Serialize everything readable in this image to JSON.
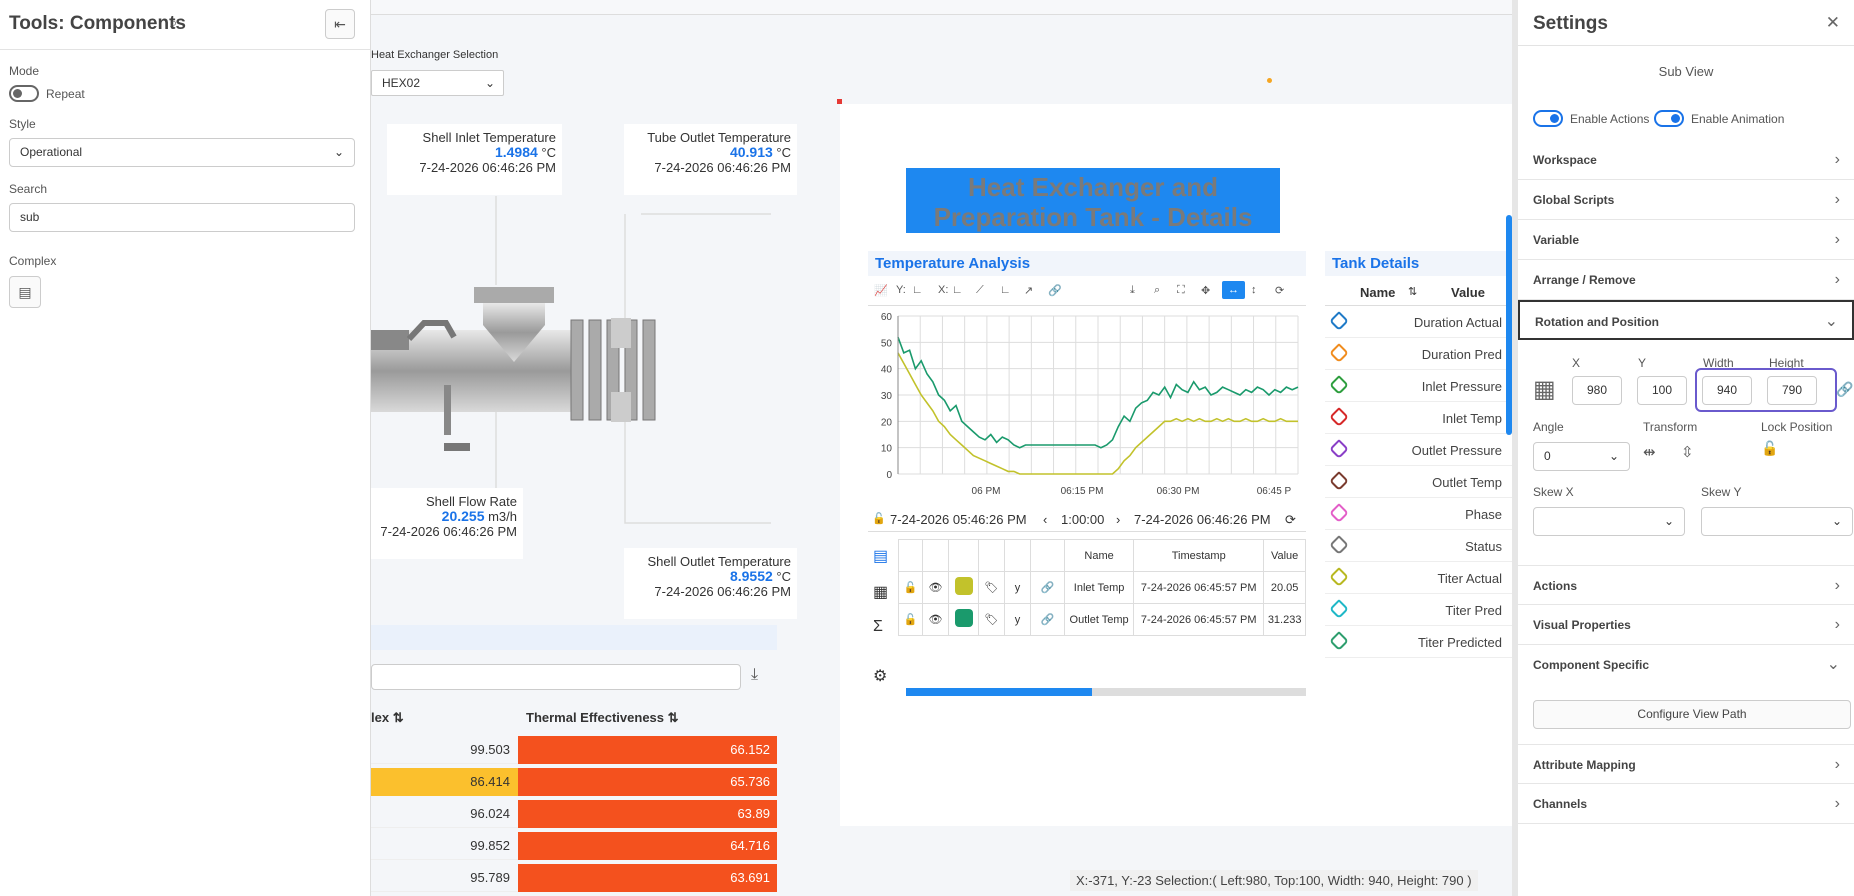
{
  "left_panel": {
    "title": "Tools: Components",
    "mode_label": "Mode",
    "mode_toggle_label": "Repeat",
    "style_label": "Style",
    "style_value": "Operational",
    "search_label": "Search",
    "search_value": "sub",
    "complex_label": "Complex"
  },
  "canvas": {
    "hex_label": "Heat Exchanger Selection",
    "hex_value": "HEX02",
    "cards": [
      {
        "title": "Shell Inlet Temperature",
        "value": "1.4984",
        "unit": " °C",
        "time": "7-24-2026 06:46:26 PM"
      },
      {
        "title": "Tube Outlet Temperature",
        "value": "40.913",
        "unit": " °C",
        "time": "7-24-2026 06:46:26 PM"
      },
      {
        "title": "Shell Flow Rate",
        "value": "20.255",
        "unit": " m3/h",
        "time": "7-24-2026 06:46:26 PM"
      },
      {
        "title": "Shell Outlet Temperature",
        "value": "8.9552",
        "unit": " °C",
        "time": "7-24-2026 06:46:26 PM"
      }
    ],
    "table": {
      "col1": "lex",
      "col2": "Thermal Effectiveness",
      "sort": "⇅",
      "rows": [
        [
          "99.503",
          "66.152"
        ],
        [
          "86.414",
          "65.736"
        ],
        [
          "96.024",
          "63.89"
        ],
        [
          "99.852",
          "64.716"
        ],
        [
          "95.789",
          "63.691"
        ]
      ]
    }
  },
  "detail": {
    "banner": "Heat Exchanger and Preparation Tank - Details",
    "temp_title": "Temperature Analysis",
    "tank_title": "Tank Details",
    "toolbar": {
      "y": "Y:",
      "x": "X:"
    },
    "range": {
      "start": "7-24-2026 05:46:26 PM",
      "interval": "1:00:00",
      "end": "7-24-2026 06:46:26 PM"
    },
    "legend_table": {
      "headers": [
        "Name",
        "Timestamp",
        "Value"
      ],
      "rows": [
        {
          "name": "Inlet Temp",
          "ts": "7-24-2026 06:45:57 PM",
          "value": "20.05",
          "color": "#c2c22b"
        },
        {
          "name": "Outlet Temp",
          "ts": "7-24-2026 06:45:57 PM",
          "value": "31.233",
          "color": "#1a9a6c"
        }
      ]
    },
    "tank": {
      "name_header": "Name",
      "value_header": "Value",
      "sort": "⇅",
      "items": [
        {
          "name": "Duration Actual",
          "color": "#1f7ac7"
        },
        {
          "name": "Duration Pred",
          "color": "#f08c1e"
        },
        {
          "name": "Inlet Pressure",
          "color": "#2e9e3e"
        },
        {
          "name": "Inlet Temp",
          "color": "#d62828"
        },
        {
          "name": "Outlet Pressure",
          "color": "#8a3fc7"
        },
        {
          "name": "Outlet Temp",
          "color": "#7a3b2e"
        },
        {
          "name": "Phase",
          "color": "#e35ec8"
        },
        {
          "name": "Status",
          "color": "#777777"
        },
        {
          "name": "Titer Actual",
          "color": "#b8b820"
        },
        {
          "name": "Titer Pred",
          "color": "#1fb8c7"
        },
        {
          "name": "Titer Predicted",
          "color": "#2e9e6e"
        }
      ]
    }
  },
  "chart_data": {
    "type": "line",
    "x_ticks": [
      "06 PM",
      "06:15 PM",
      "06:30 PM",
      "06:45 P"
    ],
    "ylim": [
      0,
      60
    ],
    "y_ticks": [
      "0",
      "10",
      "20",
      "30",
      "40",
      "50",
      "60"
    ],
    "grid": true,
    "series": [
      {
        "color": "#1a9a6c",
        "values": [
          52,
          46,
          47,
          40,
          43,
          38,
          35,
          30,
          28,
          24,
          26,
          20,
          18,
          16,
          14,
          13,
          15,
          12,
          14,
          13,
          11,
          10,
          11,
          11,
          11,
          11,
          11,
          11,
          11,
          11,
          11,
          11,
          11,
          11,
          11,
          10,
          11,
          13,
          18,
          22,
          20,
          25,
          27,
          28,
          31,
          30,
          33,
          29,
          34,
          32,
          31,
          35,
          32,
          33,
          30,
          31,
          33,
          32,
          31,
          30,
          32,
          31,
          33,
          32,
          30,
          32,
          31,
          33,
          32,
          33
        ]
      },
      {
        "color": "#c2c22b",
        "values": [
          46,
          42,
          38,
          34,
          30,
          27,
          24,
          20,
          18,
          15,
          13,
          11,
          9,
          7,
          6,
          5,
          4,
          3,
          2,
          1,
          1,
          0,
          0,
          0,
          0,
          0,
          0,
          0,
          0,
          0,
          0,
          0,
          0,
          0,
          0,
          0,
          0,
          0,
          2,
          5,
          7,
          10,
          12,
          14,
          16,
          18,
          20,
          20,
          21,
          20,
          21,
          20,
          21,
          20,
          20,
          21,
          20,
          21,
          20,
          20,
          21,
          20,
          20,
          21,
          20,
          20,
          21,
          20,
          20,
          20
        ]
      }
    ]
  },
  "settings": {
    "title": "Settings",
    "subview": "Sub View",
    "enable_actions": "Enable Actions",
    "enable_animation": "Enable Animation",
    "sections_top": [
      "Workspace",
      "Global Scripts",
      "Variable",
      "Arrange / Remove"
    ],
    "rotation": "Rotation and Position",
    "x_label": "X",
    "y_label": "Y",
    "width_label": "Width",
    "height_label": "Height",
    "x": "980",
    "y": "100",
    "width": "940",
    "height": "790",
    "angle_label": "Angle",
    "angle": "0",
    "transform_label": "Transform",
    "lock_label": "Lock Position",
    "skewx_label": "Skew X",
    "skewy_label": "Skew Y",
    "sections_mid": [
      "Actions",
      "Visual Properties"
    ],
    "component_specific": "Component Specific",
    "configure": "Configure View Path",
    "sections_bottom": [
      "Attribute Mapping",
      "Channels"
    ]
  },
  "status": "X:-371, Y:-23  Selection:( Left:980, Top:100, Width: 940, Height: 790 )"
}
